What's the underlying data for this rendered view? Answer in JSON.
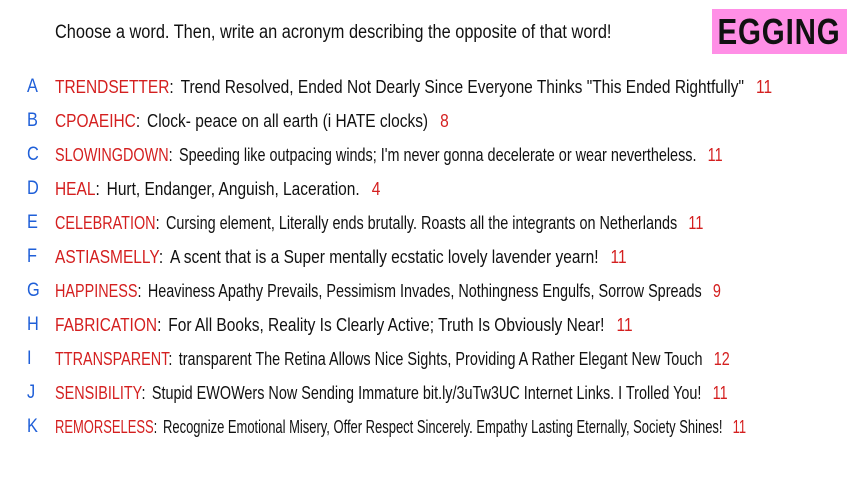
{
  "prompt": "Choose a word. Then, write an acronym describing the opposite of that word!",
  "badge": "EGGING",
  "colors": {
    "badge_bg": "#ff8fe6",
    "letter": "#1f5fd8",
    "word": "#d41f1f",
    "count": "#d41f1f"
  },
  "rows": [
    {
      "letter": "A",
      "word": "TRENDSETTER",
      "definition": "Trend Resolved, Ended Not Dearly Since Everyone Thinks \"This Ended Rightfully\"",
      "count": "11"
    },
    {
      "letter": "B",
      "word": "CPOAEIHC",
      "definition": "Clock- peace on all earth (i HATE clocks)",
      "count": "8"
    },
    {
      "letter": "C",
      "word": "SLOWINGDOWN",
      "definition": "Speeding like outpacing winds; I'm never gonna decelerate or wear nevertheless.",
      "count": "11"
    },
    {
      "letter": "D",
      "word": "HEAL",
      "definition": "Hurt, Endanger, Anguish, Laceration.",
      "count": "4"
    },
    {
      "letter": "E",
      "word": "CELEBRATION",
      "definition": "Cursing element, Literally ends brutally. Roasts all the integrants on Netherlands",
      "count": "11"
    },
    {
      "letter": "F",
      "word": "ASTIASMELLY",
      "definition": "A scent that is a Super mentally ecstatic lovely lavender yearn!",
      "count": "11"
    },
    {
      "letter": "G",
      "word": "HAPPINESS",
      "definition": "Heaviness Apathy Prevails, Pessimism Invades, Nothingness Engulfs, Sorrow Spreads",
      "count": "9"
    },
    {
      "letter": "H",
      "word": "FABRICATION",
      "definition": "For All Books, Reality Is Clearly Active; Truth Is Obviously Near!",
      "count": "11"
    },
    {
      "letter": "I",
      "word": "TTRANSPARENT",
      "definition": "transparent The Retina Allows Nice Sights, Providing A Rather Elegant New Touch",
      "count": "12"
    },
    {
      "letter": "J",
      "word": "SENSIBILITY",
      "definition": "Stupid EWOWers Now Sending Immature bit.ly/3uTw3UC Internet Links. I Trolled You!",
      "count": "11"
    },
    {
      "letter": "K",
      "word": "REMORSELESS",
      "definition": "Recognize Emotional Misery, Offer Respect Sincerely. Empathy Lasting Eternally, Society Shines!",
      "count": "11"
    }
  ]
}
